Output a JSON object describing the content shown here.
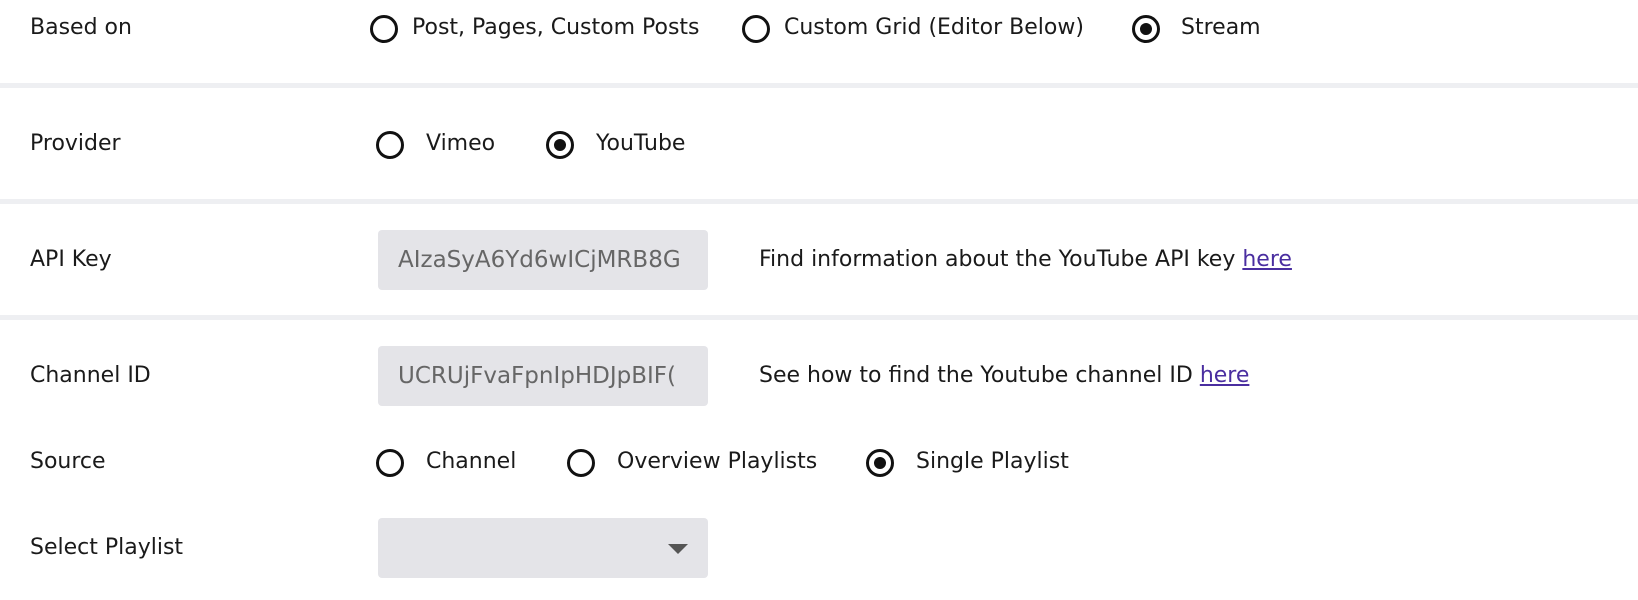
{
  "based_on": {
    "label": "Based on",
    "options": [
      {
        "label": "Post, Pages, Custom Posts",
        "checked": false
      },
      {
        "label": "Custom Grid (Editor Below)",
        "checked": false
      },
      {
        "label": "Stream",
        "checked": true
      }
    ]
  },
  "provider": {
    "label": "Provider",
    "options": [
      {
        "label": "Vimeo",
        "checked": false
      },
      {
        "label": "YouTube",
        "checked": true
      }
    ]
  },
  "api_key": {
    "label": "API Key",
    "value": "AIzaSyA6Yd6wICjMRB8G",
    "help_text": "Find information about the YouTube API key ",
    "help_link": "here"
  },
  "channel_id": {
    "label": "Channel ID",
    "value": "UCRUjFvaFpnIpHDJpBIF(",
    "help_text": "See how to find the Youtube channel ID ",
    "help_link": "here"
  },
  "source": {
    "label": "Source",
    "options": [
      {
        "label": "Channel",
        "checked": false
      },
      {
        "label": "Overview Playlists",
        "checked": false
      },
      {
        "label": "Single Playlist",
        "checked": true
      }
    ]
  },
  "select_playlist": {
    "label": "Select Playlist",
    "value": ""
  }
}
